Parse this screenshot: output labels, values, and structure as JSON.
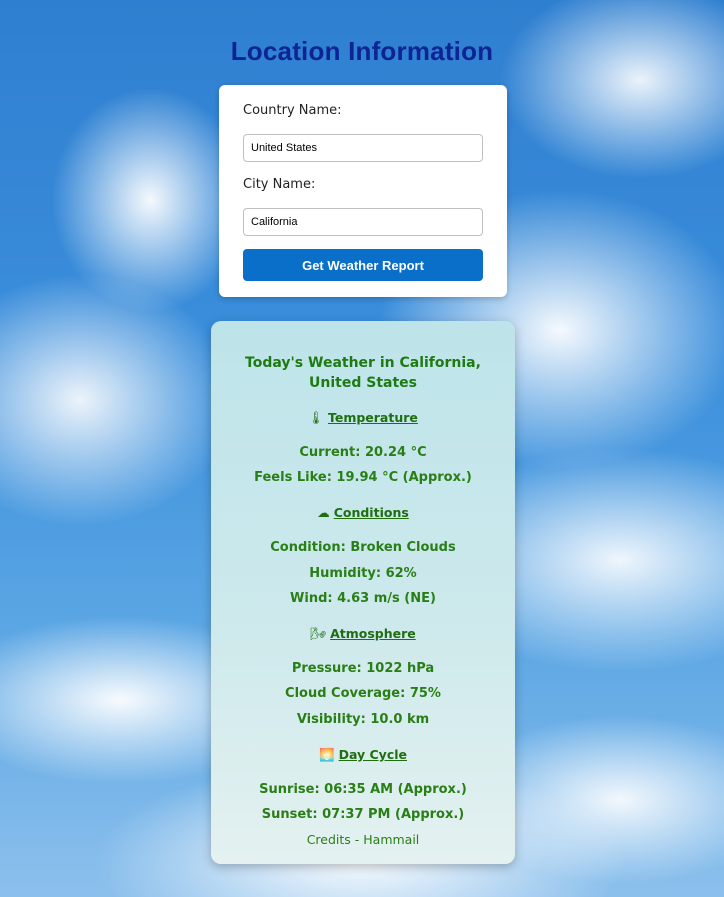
{
  "page": {
    "title": "Location Information"
  },
  "form": {
    "country_label": "Country Name:",
    "country_value": "United States",
    "city_label": "City Name:",
    "city_value": "California",
    "submit_label": "Get Weather Report"
  },
  "weather": {
    "title_line1": "Today's Weather in California,",
    "title_line2": "United States",
    "sections": {
      "temperature": {
        "icon": "thermometer-icon",
        "icon_glyph": "🌡",
        "heading": "Temperature",
        "current": "Current: 20.24 °C",
        "feels_like": "Feels Like: 19.94 °C (Approx.)"
      },
      "conditions": {
        "icon": "cloud-icon",
        "icon_glyph": "☁",
        "heading": "Conditions",
        "condition": "Condition: Broken Clouds",
        "humidity": "Humidity: 62%",
        "wind": "Wind: 4.63 m/s (NE)"
      },
      "atmosphere": {
        "icon": "wind-icon",
        "icon_glyph": "🌬",
        "heading": "Atmosphere",
        "pressure": "Pressure: 1022 hPa",
        "cloud_coverage": "Cloud Coverage: 75%",
        "visibility": "Visibility: 10.0 km"
      },
      "day_cycle": {
        "icon": "sunrise-icon",
        "icon_glyph": "🌅",
        "heading": "Day Cycle",
        "sunrise": "Sunrise: 06:35 AM (Approx.)",
        "sunset": "Sunset: 07:37 PM (Approx.)"
      }
    },
    "credits": "Credits - Hammail"
  },
  "colors": {
    "title": "#0c2494",
    "button": "#0a6fc9",
    "weather_text": "#1f7a12"
  }
}
